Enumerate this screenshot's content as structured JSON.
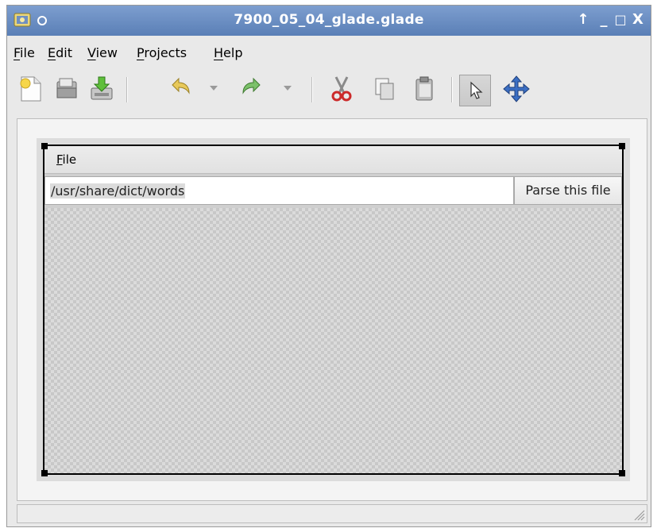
{
  "window": {
    "title": "7900_05_04_glade.glade",
    "controls": [
      "↑",
      "_",
      "□",
      "X"
    ]
  },
  "menubar": {
    "items": [
      {
        "label": "File",
        "mnemonic": "F",
        "rest": "ile"
      },
      {
        "label": "Edit",
        "mnemonic": "E",
        "rest": "dit"
      },
      {
        "label": "View",
        "mnemonic": "V",
        "rest": "iew"
      },
      {
        "label": "Projects",
        "mnemonic": "P",
        "rest": "rojects"
      },
      {
        "label": "Help",
        "mnemonic": "H",
        "rest": "elp"
      }
    ]
  },
  "toolbar": {
    "icons": [
      "new-icon",
      "open-icon",
      "save-icon",
      "undo-icon",
      "redo-icon",
      "cut-icon",
      "copy-icon",
      "paste-icon",
      "pointer-icon",
      "drag-resize-icon"
    ]
  },
  "design": {
    "inner_menu_file": {
      "mnemonic": "F",
      "rest": "ile"
    },
    "entry_value": "/usr/share/dict/words",
    "button_label": "Parse this file"
  },
  "colors": {
    "titlebar": "#6b8fc4",
    "window_bg": "#e9e9e9"
  }
}
